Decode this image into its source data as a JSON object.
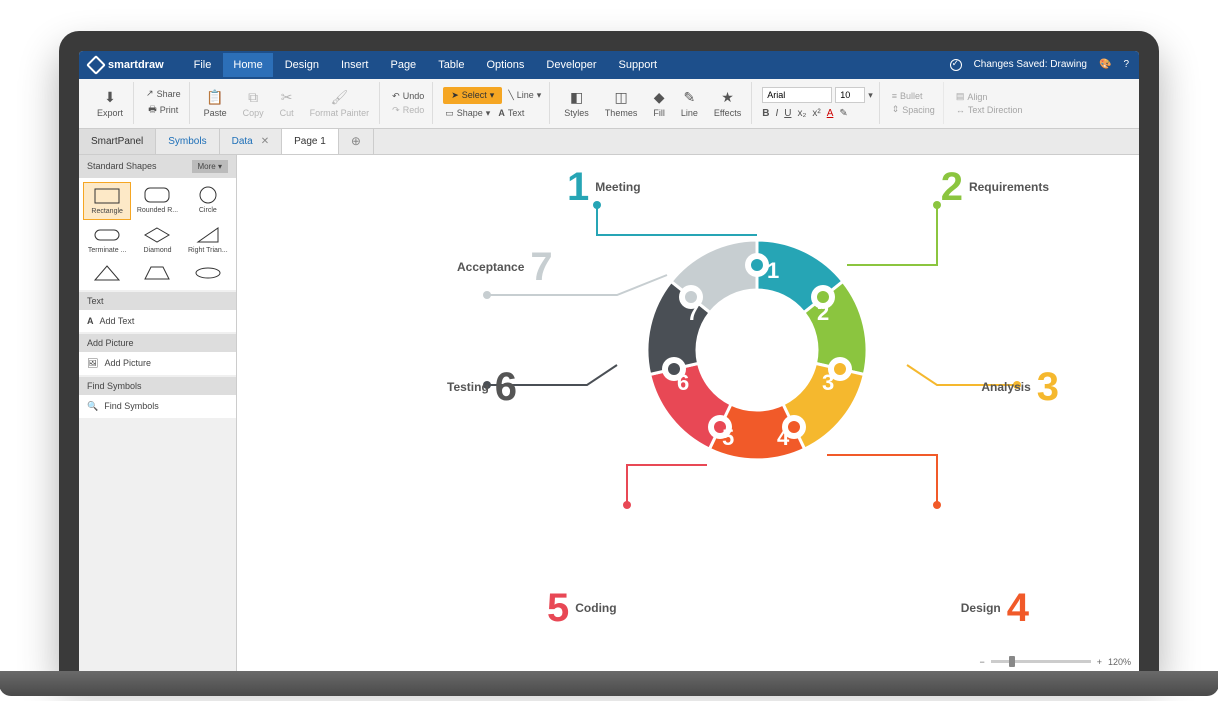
{
  "app": {
    "name": "smartdraw",
    "status": "Changes Saved: Drawing"
  },
  "menu": {
    "items": [
      "File",
      "Home",
      "Design",
      "Insert",
      "Page",
      "Table",
      "Options",
      "Developer",
      "Support"
    ],
    "active": 1
  },
  "ribbon": {
    "export": "Export",
    "share": "Share",
    "print": "Print",
    "paste": "Paste",
    "copy": "Copy",
    "cut": "Cut",
    "format_painter": "Format Painter",
    "undo": "Undo",
    "redo": "Redo",
    "select": "Select",
    "shape": "Shape",
    "line": "Line",
    "text": "Text",
    "styles": "Styles",
    "themes": "Themes",
    "fill": "Fill",
    "line2": "Line",
    "effects": "Effects",
    "font": "Arial",
    "size": "10",
    "bullet": "Bullet",
    "align": "Align",
    "spacing": "Spacing",
    "direction": "Text Direction"
  },
  "tabs": {
    "smartpanel": "SmartPanel",
    "symbols": "Symbols",
    "data": "Data",
    "page": "Page 1"
  },
  "sidebar": {
    "shapes_hdr": "Standard Shapes",
    "more": "More",
    "shapes": [
      "Rectangle",
      "Rounded R...",
      "Circle",
      "Terminate ...",
      "Diamond",
      "Right Trian..."
    ],
    "text_hdr": "Text",
    "add_text": "Add Text",
    "pic_hdr": "Add Picture",
    "add_pic": "Add Picture",
    "find_hdr": "Find Symbols",
    "find": "Find Symbols"
  },
  "diagram": {
    "segments": [
      {
        "n": "1",
        "label": "Meeting",
        "color": "#26a5b5"
      },
      {
        "n": "2",
        "label": "Requirements",
        "color": "#8bc53f"
      },
      {
        "n": "3",
        "label": "Analysis",
        "color": "#f5b82e"
      },
      {
        "n": "4",
        "label": "Design",
        "color": "#f15a29"
      },
      {
        "n": "5",
        "label": "Coding",
        "color": "#e84855"
      },
      {
        "n": "6",
        "label": "Testing",
        "color": "#4a4f55"
      },
      {
        "n": "7",
        "label": "Acceptance",
        "color": "#c7ced1"
      }
    ]
  },
  "zoom": "120%"
}
